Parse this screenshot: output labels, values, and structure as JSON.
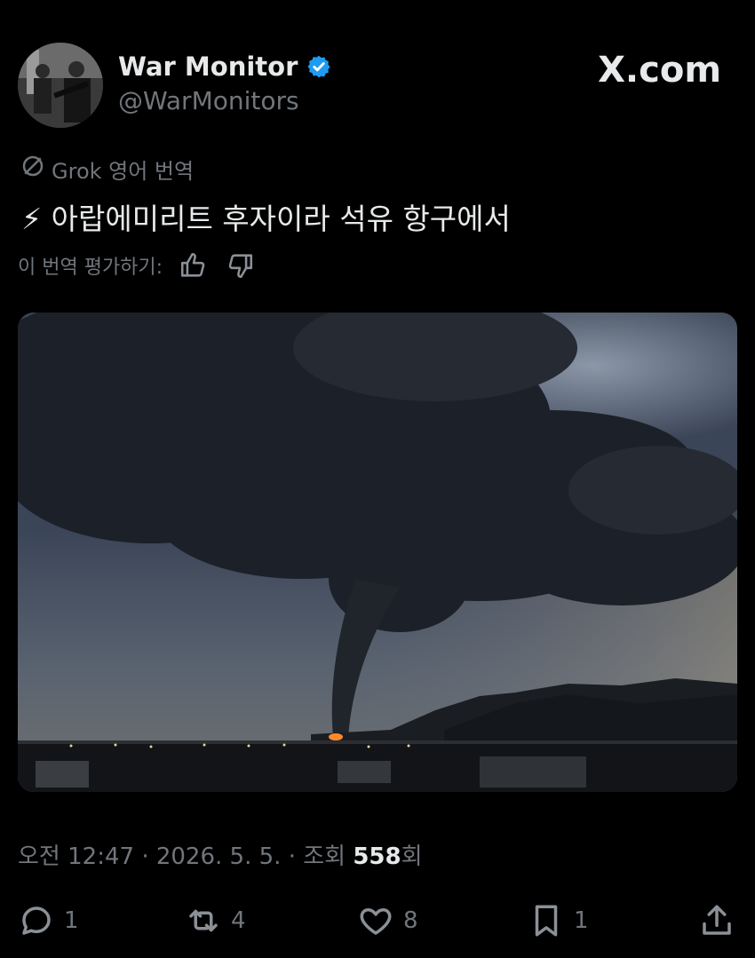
{
  "author": {
    "display_name": "War Monitor",
    "handle": "@WarMonitors",
    "verified": true
  },
  "brand": "X.com",
  "translation": {
    "label": "Grok 영어 번역",
    "rate_label": "이 번역 평가하기:"
  },
  "tweet": {
    "text": "⚡ 아랍에미리트 후자이라 석유 항구에서"
  },
  "meta": {
    "time": "오전 12:47",
    "date": "2026. 5. 5.",
    "views_prefix": "조회",
    "views_count": "558",
    "views_suffix": "회",
    "separator": "·"
  },
  "actions": {
    "replies": "1",
    "reposts": "4",
    "likes": "8",
    "bookmarks": "1"
  },
  "colors": {
    "background": "#000000",
    "text": "#e7e9ea",
    "secondary": "#71767b",
    "verified": "#1d9bf0"
  },
  "icons": [
    "verified-badge-icon",
    "grok-icon",
    "thumbs-up-icon",
    "thumbs-down-icon",
    "reply-icon",
    "repost-icon",
    "like-icon",
    "bookmark-icon",
    "share-icon"
  ]
}
